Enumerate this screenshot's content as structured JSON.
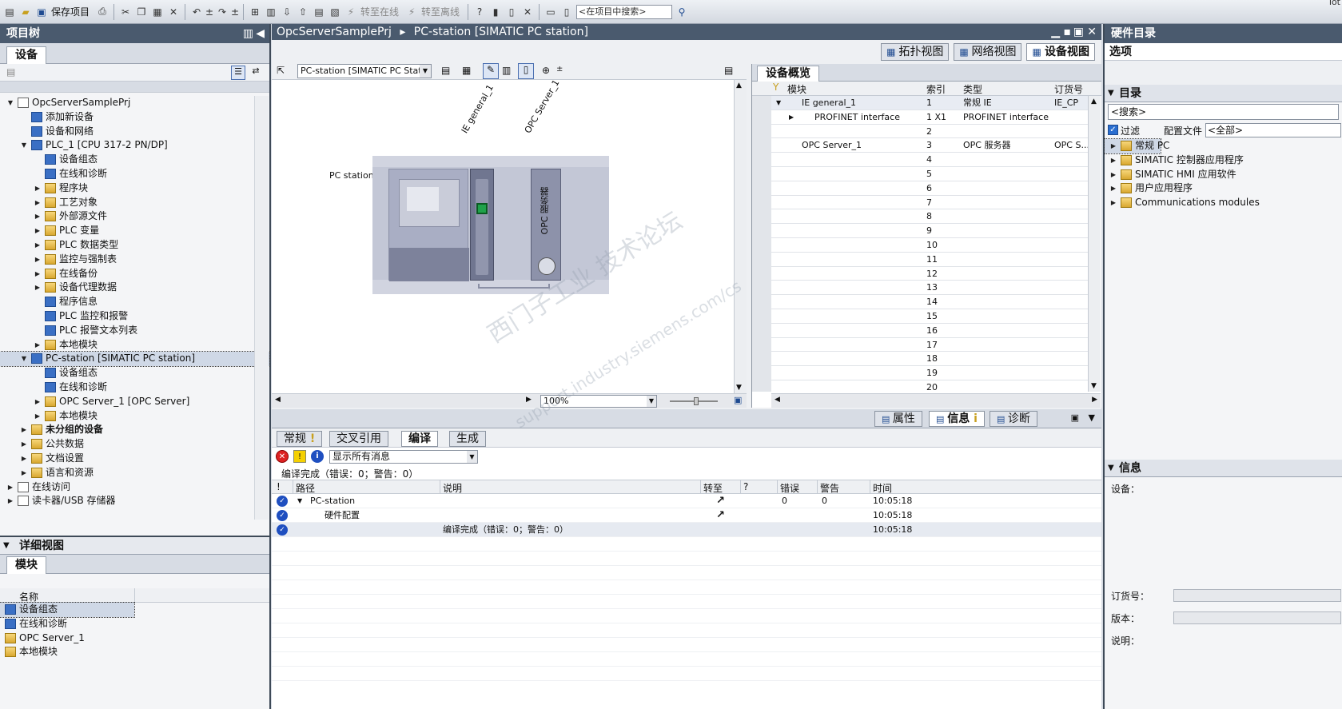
{
  "toolbar": {
    "save_label": "保存项目",
    "go_online": "转至在线",
    "go_offline": "转至离线",
    "search_placeholder": "<在项目中搜索>",
    "corner_text": "Tot"
  },
  "project_tree": {
    "title": "项目树",
    "tab": "设备",
    "items": [
      {
        "label": "OpcServerSamplePrj",
        "level": 0,
        "arrow": "▼"
      },
      {
        "label": "添加新设备",
        "level": 1,
        "arrow": ""
      },
      {
        "label": "设备和网络",
        "level": 1,
        "arrow": ""
      },
      {
        "label": "PLC_1 [CPU 317-2 PN/DP]",
        "level": 1,
        "arrow": "▼"
      },
      {
        "label": "设备组态",
        "level": 2,
        "arrow": ""
      },
      {
        "label": "在线和诊断",
        "level": 2,
        "arrow": ""
      },
      {
        "label": "程序块",
        "level": 2,
        "arrow": "▶"
      },
      {
        "label": "工艺对象",
        "level": 2,
        "arrow": "▶"
      },
      {
        "label": "外部源文件",
        "level": 2,
        "arrow": "▶"
      },
      {
        "label": "PLC 变量",
        "level": 2,
        "arrow": "▶"
      },
      {
        "label": "PLC 数据类型",
        "level": 2,
        "arrow": "▶"
      },
      {
        "label": "监控与强制表",
        "level": 2,
        "arrow": "▶"
      },
      {
        "label": "在线备份",
        "level": 2,
        "arrow": "▶"
      },
      {
        "label": "设备代理数据",
        "level": 2,
        "arrow": "▶"
      },
      {
        "label": "程序信息",
        "level": 2,
        "arrow": ""
      },
      {
        "label": "PLC 监控和报警",
        "level": 2,
        "arrow": ""
      },
      {
        "label": "PLC 报警文本列表",
        "level": 2,
        "arrow": ""
      },
      {
        "label": "本地模块",
        "level": 2,
        "arrow": "▶"
      },
      {
        "label": "PC-station [SIMATIC PC station]",
        "level": 1,
        "arrow": "▼",
        "selected": true
      },
      {
        "label": "设备组态",
        "level": 2,
        "arrow": ""
      },
      {
        "label": "在线和诊断",
        "level": 2,
        "arrow": ""
      },
      {
        "label": "OPC Server_1 [OPC Server]",
        "level": 2,
        "arrow": "▶"
      },
      {
        "label": "本地模块",
        "level": 2,
        "arrow": "▶"
      },
      {
        "label": "未分组的设备",
        "level": 1,
        "arrow": "▶",
        "bold": true
      },
      {
        "label": "公共数据",
        "level": 1,
        "arrow": "▶"
      },
      {
        "label": "文档设置",
        "level": 1,
        "arrow": "▶"
      },
      {
        "label": "语言和资源",
        "level": 1,
        "arrow": "▶"
      },
      {
        "label": "在线访问",
        "level": 0,
        "arrow": "▶"
      },
      {
        "label": "读卡器/USB 存储器",
        "level": 0,
        "arrow": "▶"
      }
    ]
  },
  "detail_view": {
    "title": "详细视图",
    "tab": "模块",
    "col_name": "名称",
    "items": [
      "设备组态",
      "在线和诊断",
      "OPC Server_1",
      "本地模块"
    ]
  },
  "editor": {
    "breadcrumb_project": "OpcServerSamplePrj",
    "breadcrumb_sep": "▸",
    "breadcrumb_station": "PC-station [SIMATIC PC station]",
    "view_tabs": [
      "拓扑视图",
      "网络视图",
      "设备视图"
    ],
    "device_select": "PC-station [SIMATIC PC Station",
    "zoom": "100%",
    "station_label": "PC station",
    "module_label_1": "IE general_1",
    "module_label_2": "OPC Server_1",
    "opc_vertical": "OPC 服务器"
  },
  "device_overview": {
    "tab": "设备概览",
    "columns": [
      "模块",
      "索引",
      "类型",
      "订货号"
    ],
    "rows": [
      {
        "module": "IE general_1",
        "index": "1",
        "type": "常规 IE",
        "order": "IE_CP",
        "indent": 1,
        "arrow": "▼"
      },
      {
        "module": "PROFINET interface",
        "index": "1 X1",
        "type": "PROFINET interface",
        "order": "",
        "indent": 2,
        "arrow": "▶"
      },
      {
        "module": "",
        "index": "2",
        "type": "",
        "order": ""
      },
      {
        "module": "OPC Server_1",
        "index": "3",
        "type": "OPC 服务器",
        "order": "OPC S...",
        "indent": 1,
        "arrow": ""
      },
      {
        "module": "",
        "index": "4"
      },
      {
        "module": "",
        "index": "5"
      },
      {
        "module": "",
        "index": "6"
      },
      {
        "module": "",
        "index": "7"
      },
      {
        "module": "",
        "index": "8"
      },
      {
        "module": "",
        "index": "9"
      },
      {
        "module": "",
        "index": "10"
      },
      {
        "module": "",
        "index": "11"
      },
      {
        "module": "",
        "index": "12"
      },
      {
        "module": "",
        "index": "13"
      },
      {
        "module": "",
        "index": "14"
      },
      {
        "module": "",
        "index": "15"
      },
      {
        "module": "",
        "index": "16"
      },
      {
        "module": "",
        "index": "17"
      },
      {
        "module": "",
        "index": "18"
      },
      {
        "module": "",
        "index": "19"
      },
      {
        "module": "",
        "index": "20"
      }
    ]
  },
  "inspector": {
    "tabs": [
      "属性",
      "信息",
      "诊断"
    ],
    "sub_tabs": [
      "常规",
      "交叉引用",
      "编译",
      "生成"
    ],
    "filter_select": "显示所有消息",
    "summary": "编译完成（错误：0；警告：0）",
    "columns": [
      "!",
      "路径",
      "说明",
      "转至",
      "?",
      "错误",
      "警告",
      "时间"
    ],
    "messages": [
      {
        "path": "PC-station",
        "desc": "",
        "errors": "0",
        "warnings": "0",
        "time": "10:05:18",
        "arrow": "▼",
        "goto": "↗"
      },
      {
        "path": "硬件配置",
        "desc": "",
        "errors": "",
        "warnings": "",
        "time": "10:05:18",
        "arrow": "",
        "goto": "↗"
      },
      {
        "path": "",
        "desc": "编译完成（错误：0；警告：0）",
        "errors": "",
        "warnings": "",
        "time": "10:05:18",
        "arrow": "",
        "goto": ""
      }
    ]
  },
  "catalog": {
    "title": "硬件目录",
    "options": "选项",
    "section_catalog": "目录",
    "search_placeholder": "<搜索>",
    "filter": "过滤",
    "profile_label": "配置文件",
    "profile_value": "<全部>",
    "items": [
      "常规 PC",
      "SIMATIC 控制器应用程序",
      "SIMATIC HMI 应用软件",
      "用户应用程序",
      "Communications modules"
    ],
    "section_info": "信息",
    "device_label": "设备：",
    "order_label": "订货号：",
    "version_label": "版本：",
    "desc_label": "说明："
  },
  "watermark": {
    "line1": "西门子工业  技术论坛",
    "line2": "support.industry.siemens.com/cs"
  }
}
